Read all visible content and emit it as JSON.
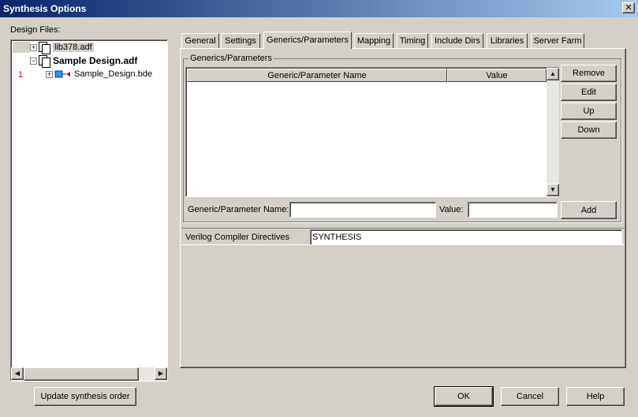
{
  "window": {
    "title": "Synthesis Options",
    "close_glyph": "✕"
  },
  "design_files": {
    "label": "Design Files:",
    "items": [
      {
        "number": "",
        "expander": "+",
        "label": "lib378.adf",
        "bold": false
      },
      {
        "number": "",
        "expander": "−",
        "label": "Sample Design.adf",
        "bold": true
      },
      {
        "number": "1",
        "expander": "+",
        "label": "Sample_Design.bde",
        "bold": false
      }
    ]
  },
  "tabs": [
    {
      "label": "General"
    },
    {
      "label": "Settings"
    },
    {
      "label": "Generics/Parameters",
      "active": true
    },
    {
      "label": "Mapping"
    },
    {
      "label": "Timing"
    },
    {
      "label": "Include Dirs"
    },
    {
      "label": "Libraries"
    },
    {
      "label": "Server Farm"
    }
  ],
  "generics": {
    "group_title": "Generics/Parameters",
    "columns": [
      "Generic/Parameter Name",
      "Value"
    ],
    "rows": [],
    "buttons": {
      "remove": "Remove",
      "edit": "Edit",
      "up": "Up",
      "down": "Down",
      "add": "Add"
    },
    "name_label": "Generic/Parameter Name:",
    "name_value": "",
    "value_label": "Value:",
    "value_value": ""
  },
  "verilog": {
    "label": "Verilog Compiler Directives",
    "value": "SYNTHESIS"
  },
  "footer": {
    "update_order": "Update synthesis order",
    "ok": "OK",
    "cancel": "Cancel",
    "help": "Help"
  },
  "colors": {
    "titlebar_start": "#0a246a",
    "titlebar_end": "#a6caf0",
    "face": "#d4d0c8",
    "marker": "#cc0000"
  }
}
